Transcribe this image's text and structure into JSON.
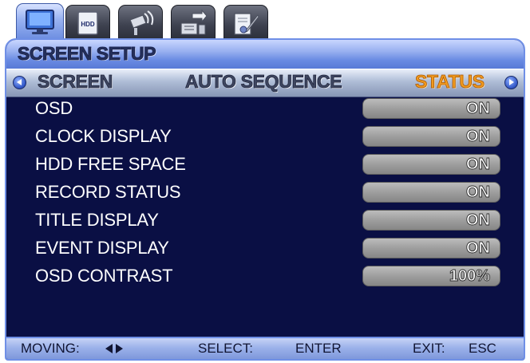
{
  "tabs": [
    {
      "icon": "monitor-icon",
      "active": true
    },
    {
      "icon": "hdd-icon",
      "label": "HDD",
      "active": false
    },
    {
      "icon": "camera-icon",
      "active": false
    },
    {
      "icon": "network-icon",
      "active": false
    },
    {
      "icon": "system-tools-icon",
      "active": false
    }
  ],
  "window": {
    "title": "SCREEN SETUP"
  },
  "subtabs": [
    {
      "label": "SCREEN",
      "active": false
    },
    {
      "label": "AUTO SEQUENCE",
      "active": false
    },
    {
      "label": "STATUS",
      "active": true
    }
  ],
  "settings": [
    {
      "label": "OSD",
      "value": "ON"
    },
    {
      "label": "CLOCK DISPLAY",
      "value": "ON"
    },
    {
      "label": "HDD FREE SPACE",
      "value": "ON"
    },
    {
      "label": "RECORD STATUS",
      "value": "ON"
    },
    {
      "label": "TITLE DISPLAY",
      "value": "ON"
    },
    {
      "label": "EVENT DISPLAY",
      "value": "ON"
    },
    {
      "label": "OSD CONTRAST",
      "value": "100%"
    }
  ],
  "footer": {
    "moving_label": "MOVING:",
    "select_label": "SELECT:",
    "select_key": "ENTER",
    "exit_label": "EXIT:",
    "exit_key": "ESC"
  },
  "colors": {
    "panel_background": "#0a0f44",
    "active_subtab": "#f19a1d",
    "value_box": "#a0a0a0"
  }
}
